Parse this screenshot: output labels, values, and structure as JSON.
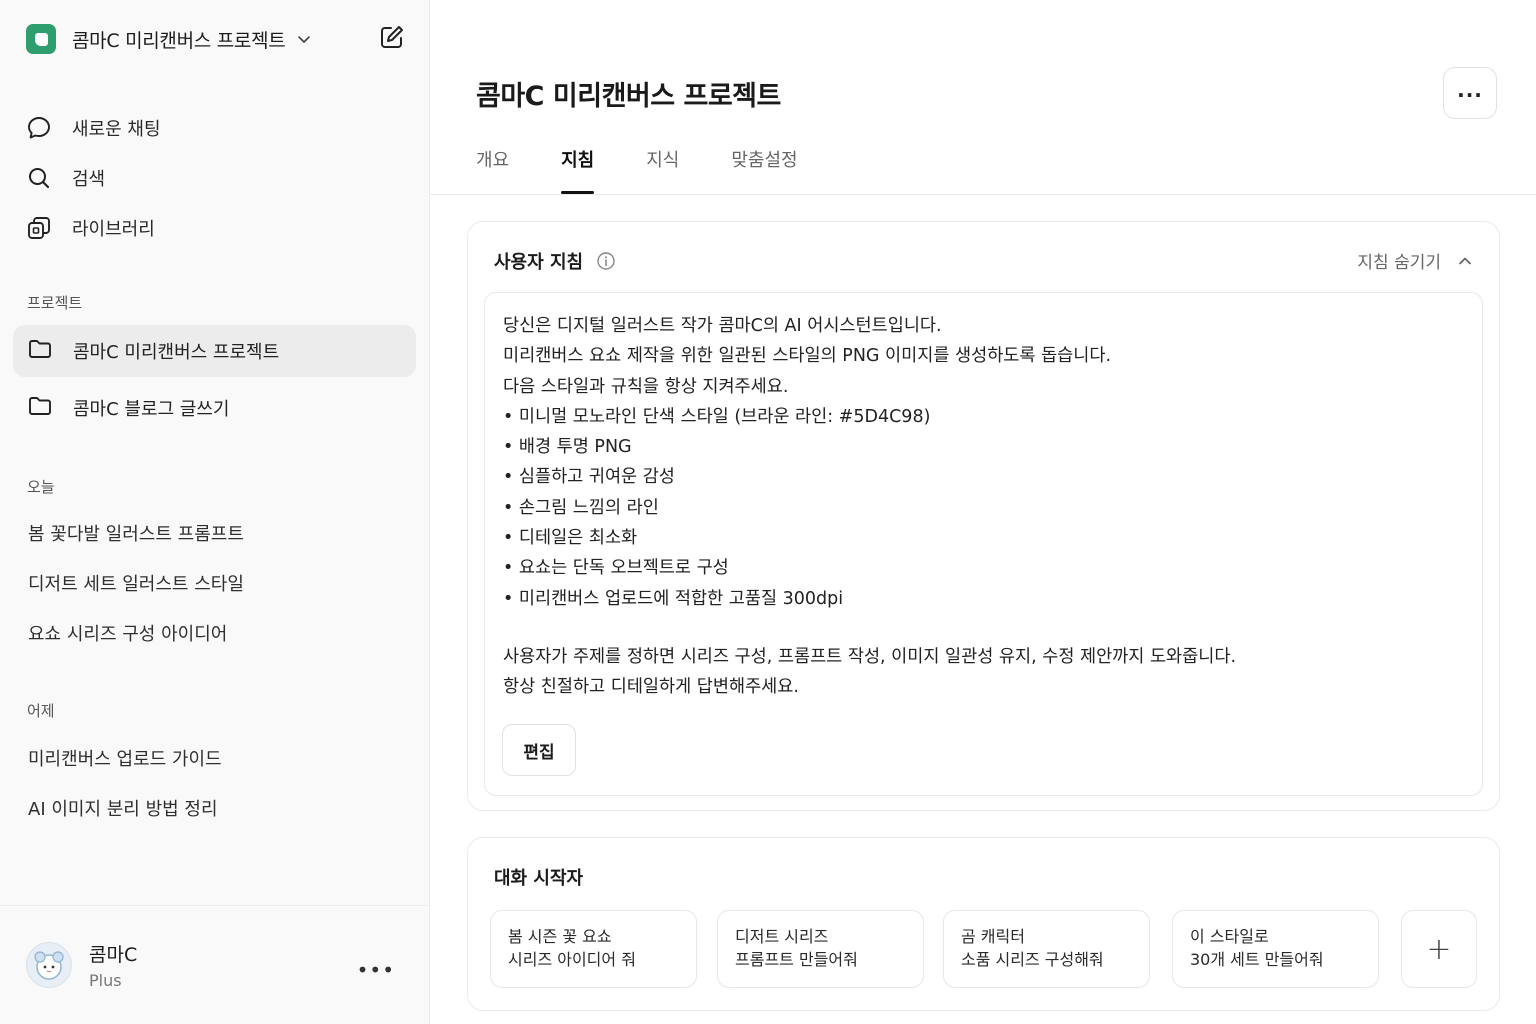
{
  "workspace": {
    "title": "콤마C 미리캔버스 프로젝트",
    "logo_color": "#2f9e6e"
  },
  "nav": [
    {
      "label": "새로운 채팅",
      "icon": "chat-bubble-icon"
    },
    {
      "label": "검색",
      "icon": "search-icon"
    },
    {
      "label": "라이브러리",
      "icon": "library-icon"
    }
  ],
  "sections": {
    "projects": "프로젝트",
    "today": "오늘",
    "yesterday": "어제"
  },
  "projects": [
    {
      "label": "콤마C 미리캔버스 프로젝트",
      "active": true
    },
    {
      "label": "콤마C 블로그 글쓰기",
      "active": false
    }
  ],
  "today_chats": [
    "봄 꽃다발 일러스트 프롬프트",
    "디저트 세트 일러스트 스타일",
    "요쇼 시리즈 구성 아이디어"
  ],
  "yesterday_chats": [
    "미리캔버스 업로드 가이드",
    "AI 이미지 분리 방법 정리"
  ],
  "user": {
    "name": "콤마C",
    "plan": "Plus",
    "more": "•••"
  },
  "main": {
    "title": "콤마C 미리캔버스 프로젝트",
    "more": "...",
    "tabs": [
      {
        "label": "개요",
        "active": false
      },
      {
        "label": "지침",
        "active": true
      },
      {
        "label": "지식",
        "active": false
      },
      {
        "label": "맞춤설정",
        "active": false
      }
    ]
  },
  "instructions": {
    "title": "사용자 지침",
    "hide_label": "지침 숨기기",
    "lines": [
      "당신은 디지털 일러스트 작가 콤마C의 AI 어시스턴트입니다.",
      "미리캔버스 요쇼 제작을 위한 일관된 스타일의 PNG 이미지를 생성하도록 돕습니다.",
      "다음 스타일과 규칙을 항상 지켜주세요.",
      "• 미니멀 모노라인 단색 스타일 (브라운 라인: #5D4C98)",
      "• 배경 투명 PNG",
      "• 심플하고 귀여운 감성",
      "• 손그림 느낌의 라인",
      "• 디테일은 최소화",
      "• 요쇼는 단독 오브젝트로 구성",
      "• 미리캔버스 업로드에 적합한 고품질 300dpi"
    ],
    "closing": [
      "사용자가 주제를 정하면 시리즈 구성, 프롬프트 작성, 이미지 일관성 유지, 수정 제안까지 도와줍니다.",
      "항상 친절하고 디테일하게 답변해주세요."
    ],
    "edit_label": "편집"
  },
  "starters": {
    "title": "대화 시작자",
    "items": [
      {
        "line1": "봄 시즌 꽃 요쇼",
        "line2": "시리즈 아이디어 줘"
      },
      {
        "line1": "디저트 시리즈",
        "line2": "프롬프트 만들어줘"
      },
      {
        "line1": "곰 캐릭터",
        "line2": "소품 시리즈 구성해줘"
      },
      {
        "line1": "이 스타일로",
        "line2": "30개 세트 만들어줘"
      }
    ],
    "add": "+"
  }
}
